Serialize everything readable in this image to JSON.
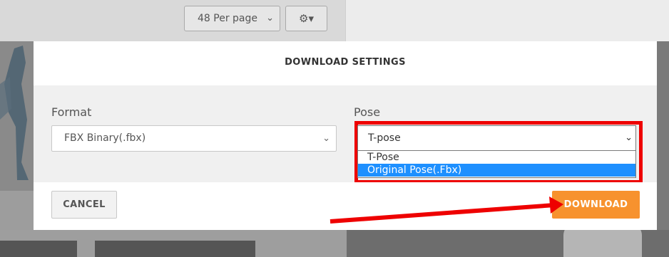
{
  "toolbar": {
    "per_page_value": "48 Per page",
    "per_page_icon": "chevron-down-icon",
    "settings_icon": "gear-icon"
  },
  "modal": {
    "title": "DOWNLOAD SETTINGS",
    "format": {
      "label": "Format",
      "value": "FBX Binary(.fbx)"
    },
    "pose": {
      "label": "Pose",
      "value": "T-pose",
      "options": [
        {
          "label": "T-Pose",
          "selected": false
        },
        {
          "label": "Original Pose(.Fbx)",
          "selected": true
        }
      ]
    },
    "cancel_label": "CANCEL",
    "download_label": "DOWNLOAD"
  },
  "colors": {
    "accent": "#f7922e",
    "highlight": "#ee0000",
    "selection": "#1e90ff"
  }
}
